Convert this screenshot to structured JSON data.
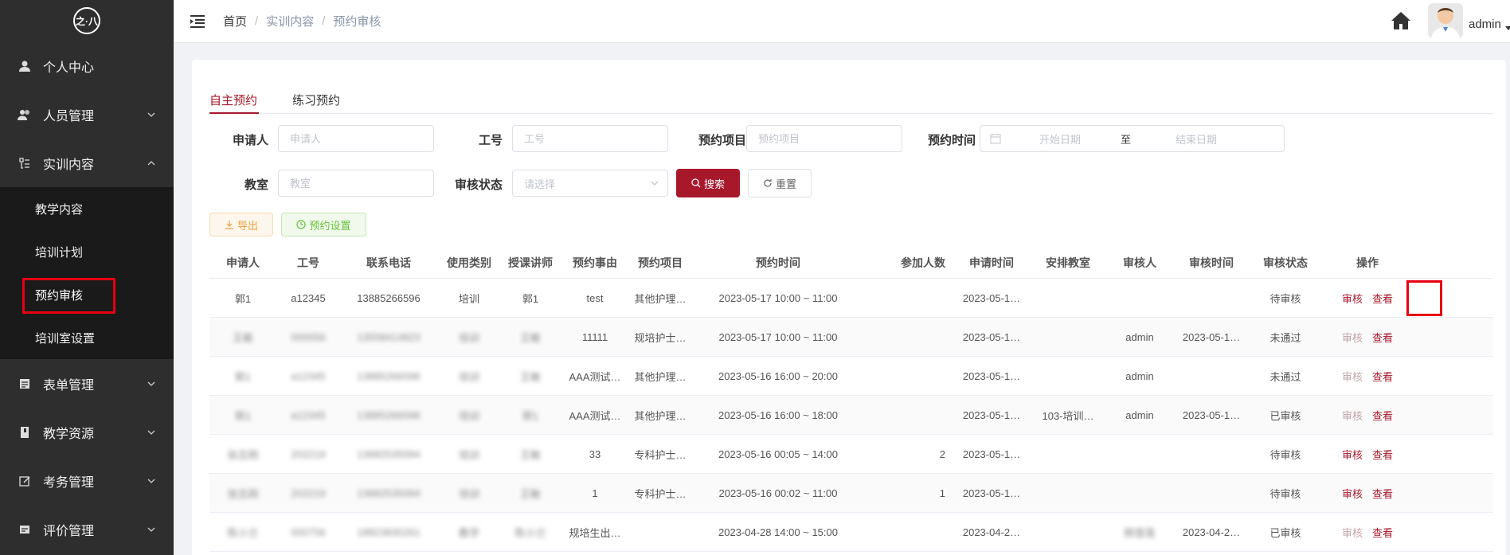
{
  "logo": {
    "text": "之·八"
  },
  "sidebar": {
    "items": [
      {
        "label": "个人中心",
        "icon": "user-icon"
      },
      {
        "label": "人员管理",
        "icon": "users-icon"
      },
      {
        "label": "实训内容",
        "icon": "list-icon",
        "expanded": true
      },
      {
        "label": "表单管理",
        "icon": "form-icon"
      },
      {
        "label": "教学资源",
        "icon": "book-icon"
      },
      {
        "label": "考务管理",
        "icon": "edit-icon"
      },
      {
        "label": "评价管理",
        "icon": "rating-icon"
      }
    ],
    "sub_items": [
      {
        "label": "教学内容"
      },
      {
        "label": "培训计划"
      },
      {
        "label": "预约审核",
        "active": true
      },
      {
        "label": "培训室设置"
      }
    ]
  },
  "header": {
    "breadcrumb": [
      "首页",
      "实训内容",
      "预约审核"
    ],
    "user": "admin"
  },
  "tabs": [
    {
      "label": "自主预约",
      "active": true
    },
    {
      "label": "练习预约"
    }
  ],
  "filters": {
    "applicant": {
      "label": "申请人",
      "placeholder": "申请人"
    },
    "job_no": {
      "label": "工号",
      "placeholder": "工号"
    },
    "project": {
      "label": "预约项目",
      "placeholder": "预约项目"
    },
    "time": {
      "label": "预约时间",
      "start": "开始日期",
      "to": "至",
      "end": "结束日期"
    },
    "classroom": {
      "label": "教室",
      "placeholder": "教室"
    },
    "status": {
      "label": "审核状态",
      "placeholder": "请选择"
    },
    "search_btn": "搜索",
    "reset_btn": "重置"
  },
  "actions": {
    "export": "导出",
    "settings": "预约设置"
  },
  "table": {
    "columns": [
      "申请人",
      "工号",
      "联系电话",
      "使用类别",
      "授课讲师",
      "预约事由",
      "预约项目",
      "预约时间",
      "参加人数",
      "申请时间",
      "安排教室",
      "审核人",
      "审核时间",
      "审核状态",
      "操作"
    ],
    "op_audit": "审核",
    "op_view": "查看",
    "rows": [
      {
        "applicant": "郭1",
        "job_no": "a12345",
        "phone": "13885266596",
        "category": "培训",
        "lecturer": "郭1",
        "reason": "test",
        "project": "其他护理…",
        "time": "2023-05-17 10:00 ~ 11:00",
        "count": "",
        "apply_time": "2023-05-1…",
        "room": "",
        "auditor": "",
        "audit_time": "",
        "status": "待审核",
        "audit_enabled": true,
        "blur": false
      },
      {
        "applicant": "王敏",
        "job_no": "000056",
        "phone": "13558414823",
        "category": "培训",
        "lecturer": "王敏",
        "reason": "11111",
        "project": "规培护士…",
        "time": "2023-05-17 10:00 ~ 11:00",
        "count": "",
        "apply_time": "2023-05-1…",
        "room": "",
        "auditor": "admin",
        "audit_time": "2023-05-1…",
        "status": "未通过",
        "audit_enabled": false,
        "blur": true
      },
      {
        "applicant": "郭1",
        "job_no": "a12345",
        "phone": "13885266596",
        "category": "培训",
        "lecturer": "王敏",
        "reason": "AAA测试…",
        "project": "其他护理…",
        "time": "2023-05-16 16:00 ~ 20:00",
        "count": "",
        "apply_time": "2023-05-1…",
        "room": "",
        "auditor": "admin",
        "audit_time": "",
        "status": "未通过",
        "audit_enabled": false,
        "blur": true
      },
      {
        "applicant": "郭1",
        "job_no": "a12345",
        "phone": "13885266596",
        "category": "培训",
        "lecturer": "郭1",
        "reason": "AAA测试…",
        "project": "其他护理…",
        "time": "2023-05-16 16:00 ~ 18:00",
        "count": "",
        "apply_time": "2023-05-1…",
        "room": "103-培训…",
        "auditor": "admin",
        "audit_time": "2023-05-1…",
        "status": "已审核",
        "audit_enabled": false,
        "blur": true
      },
      {
        "applicant": "张志刚",
        "job_no": "202219",
        "phone": "13682535094",
        "category": "培训",
        "lecturer": "王敏",
        "reason": "33",
        "project": "专科护士…",
        "time": "2023-05-16 00:05 ~ 14:00",
        "count": "2",
        "apply_time": "2023-05-1…",
        "room": "",
        "auditor": "",
        "audit_time": "",
        "status": "待审核",
        "audit_enabled": true,
        "blur": true
      },
      {
        "applicant": "张志刚",
        "job_no": "202219",
        "phone": "13682535094",
        "category": "培训",
        "lecturer": "王敏",
        "reason": "1",
        "project": "专科护士…",
        "time": "2023-05-16 00:02 ~ 11:00",
        "count": "1",
        "apply_time": "2023-05-1…",
        "room": "",
        "auditor": "",
        "audit_time": "",
        "status": "待审核",
        "audit_enabled": true,
        "blur": true
      },
      {
        "applicant": "陈小兰",
        "job_no": "000756",
        "phone": "18823830261",
        "category": "教学",
        "lecturer": "陈小兰",
        "reason": "规培生出…",
        "project": "",
        "time": "2023-04-28 14:00 ~ 15:00",
        "count": "",
        "apply_time": "2023-04-2…",
        "room": "",
        "auditor": "韩雪莲",
        "audit_time": "2023-04-2…",
        "status": "已审核",
        "audit_enabled": false,
        "blur": true
      }
    ]
  }
}
